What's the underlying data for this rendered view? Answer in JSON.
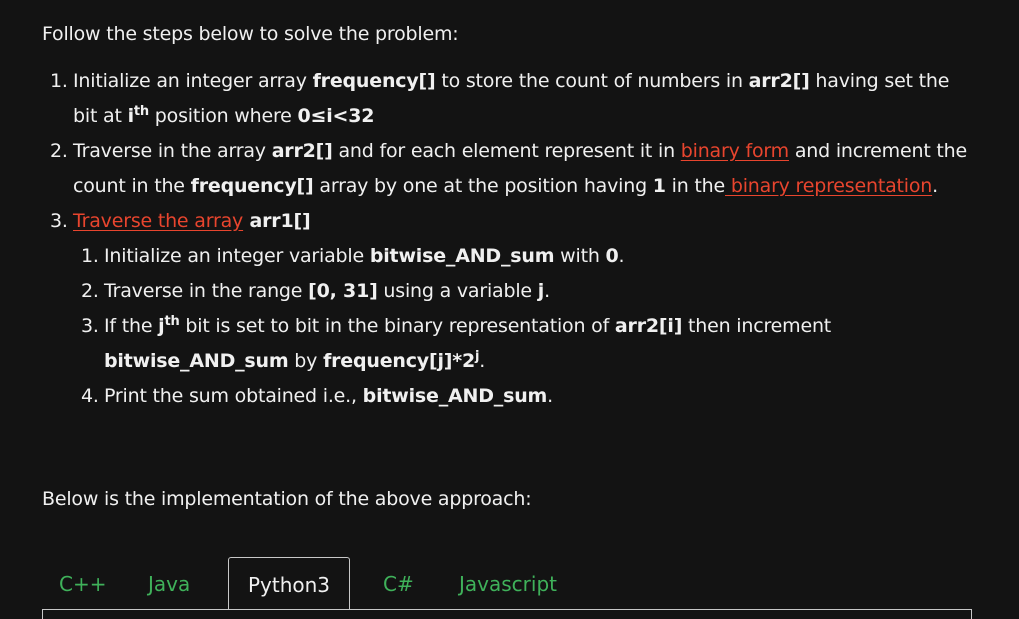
{
  "intro": "Follow the steps below to solve the problem:",
  "steps": [
    {
      "num": "1.",
      "t1": "Initialize an integer array ",
      "b1": "frequency[]",
      "t2": " to store the count of numbers in ",
      "b2": "arr2[]",
      "t3": " having set the bit at ",
      "b3": "i",
      "sup": "th",
      "t4": " position where ",
      "b4": "0≤i<32"
    },
    {
      "num": "2.",
      "t1": "Traverse in the array ",
      "b1": "arr2[]",
      "t2": " and for each element represent it in ",
      "link1": "binary form",
      "t3": " and increment the count in the ",
      "b2": "frequency[]",
      "t4": " array by one at the position having ",
      "b3": "1",
      "t5": " in the",
      "link2": " binary representation",
      "t6": "."
    },
    {
      "num": "3.",
      "link1": "Traverse the array",
      "b1": " arr1[]",
      "sub": [
        {
          "num": "1.",
          "t1": "Initialize an integer variable ",
          "b1": "bitwise_AND_sum",
          "t2": " with ",
          "b2": "0",
          "t3": "."
        },
        {
          "num": "2.",
          "t1": "Traverse in the range ",
          "b1": "[0, 31]",
          "t2": " using a variable ",
          "b2": "j",
          "t3": "."
        },
        {
          "num": "3.",
          "t1": "If the ",
          "b1": "j",
          "sup1": "th",
          "t2": " bit is set to bit in the binary representation of ",
          "b2": "arr2[i]",
          "t3": " then increment ",
          "b3": "bitwise_AND_sum",
          "t4": " by ",
          "b4": "frequency[j]*2",
          "sup2": "j",
          "t5": "."
        },
        {
          "num": "4.",
          "t1": "Print the sum obtained i.e., ",
          "b1": "bitwise_AND_sum",
          "t2": "."
        }
      ]
    }
  ],
  "below": "Below is the implementation of the above approach:",
  "tabs": [
    "C++",
    "Java",
    "Python3",
    "C#",
    "Javascript"
  ],
  "active_tab": "Python3",
  "colors": {
    "background": "#131313",
    "text": "#f0f0f0",
    "link": "#e8452e",
    "tab_inactive": "#3fb15a"
  }
}
